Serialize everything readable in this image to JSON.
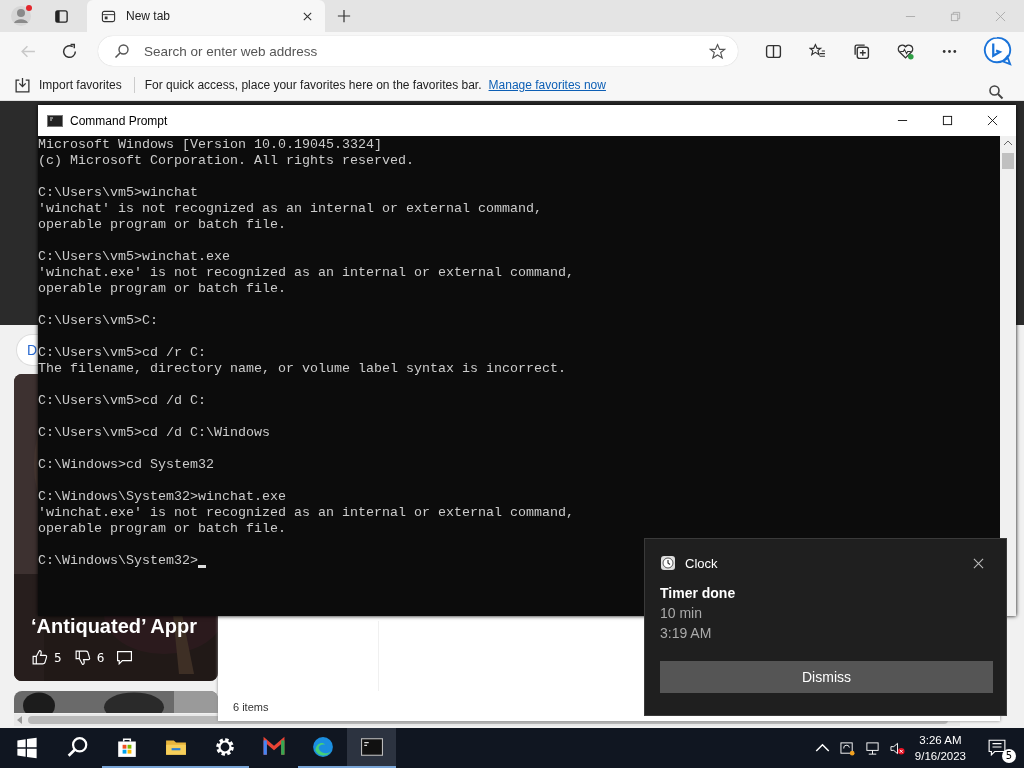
{
  "browser": {
    "tabs": [
      {
        "label": "New tab",
        "selected": true
      }
    ],
    "back_disabled": true,
    "address_bar": {
      "placeholder": "Search or enter web address"
    },
    "favorites_bar": {
      "import_label": "Import favorites",
      "hint": "For quick access, place your favorites here on the favorites bar.",
      "link": "Manage favorites now"
    },
    "feed": {
      "pill": "D",
      "cards": [
        {
          "headline_lines": [
            "‘Antiquated’ Appr"
          ],
          "likes": "5",
          "dislikes": "6"
        }
      ]
    }
  },
  "command_prompt": {
    "title": "Command Prompt",
    "blocks": [
      [
        "Microsoft Windows [Version 10.0.19045.3324]",
        "(c) Microsoft Corporation. All rights reserved."
      ],
      [
        "C:\\Users\\vm5>winchat",
        "'winchat' is not recognized as an internal or external command,",
        "operable program or batch file."
      ],
      [
        "C:\\Users\\vm5>winchat.exe",
        "'winchat.exe' is not recognized as an internal or external command,",
        "operable program or batch file."
      ],
      [
        "C:\\Users\\vm5>C:"
      ],
      [
        "C:\\Users\\vm5>cd /r C:",
        "The filename, directory name, or volume label syntax is incorrect."
      ],
      [
        "C:\\Users\\vm5>cd /d C:"
      ],
      [
        "C:\\Users\\vm5>cd /d C:\\Windows"
      ],
      [
        "C:\\Windows>cd System32"
      ],
      [
        "C:\\Windows\\System32>winchat.exe",
        "'winchat.exe' is not recognized as an internal or external command,",
        "operable program or batch file."
      ]
    ],
    "prompt": "C:\\Windows\\System32>"
  },
  "explorer": {
    "status": "6 items"
  },
  "notification": {
    "app": "Clock",
    "title": "Timer done",
    "lines": [
      "10 min",
      "3:19 AM"
    ],
    "button": "Dismiss"
  },
  "taskbar": {
    "apps": [
      {
        "kind": "search",
        "running": false,
        "selected": false
      },
      {
        "kind": "store",
        "running": true,
        "selected": false
      },
      {
        "kind": "explorer",
        "running": true,
        "selected": false
      },
      {
        "kind": "settings",
        "running": true,
        "selected": false
      },
      {
        "kind": "mail",
        "running": false,
        "selected": false
      },
      {
        "kind": "edge",
        "running": true,
        "selected": false
      },
      {
        "kind": "terminal",
        "running": true,
        "selected": true
      }
    ],
    "volume_muted": true,
    "time": "3:26 AM",
    "date": "9/16/2023",
    "notification_count": "5"
  }
}
